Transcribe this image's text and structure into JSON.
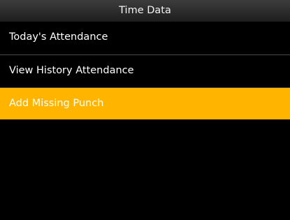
{
  "screen": {
    "title": "Time Data"
  },
  "menu": {
    "items": [
      {
        "label": "Today's Attendance",
        "selected": false
      },
      {
        "label": "View History Attendance",
        "selected": false
      },
      {
        "label": "Add Missing Punch",
        "selected": true
      }
    ]
  },
  "colors": {
    "background": "#000000",
    "title_bar": "#2a2a2a",
    "selected_item": "#ffb400",
    "text": "#ffffff",
    "divider": "#4a4a4a"
  }
}
